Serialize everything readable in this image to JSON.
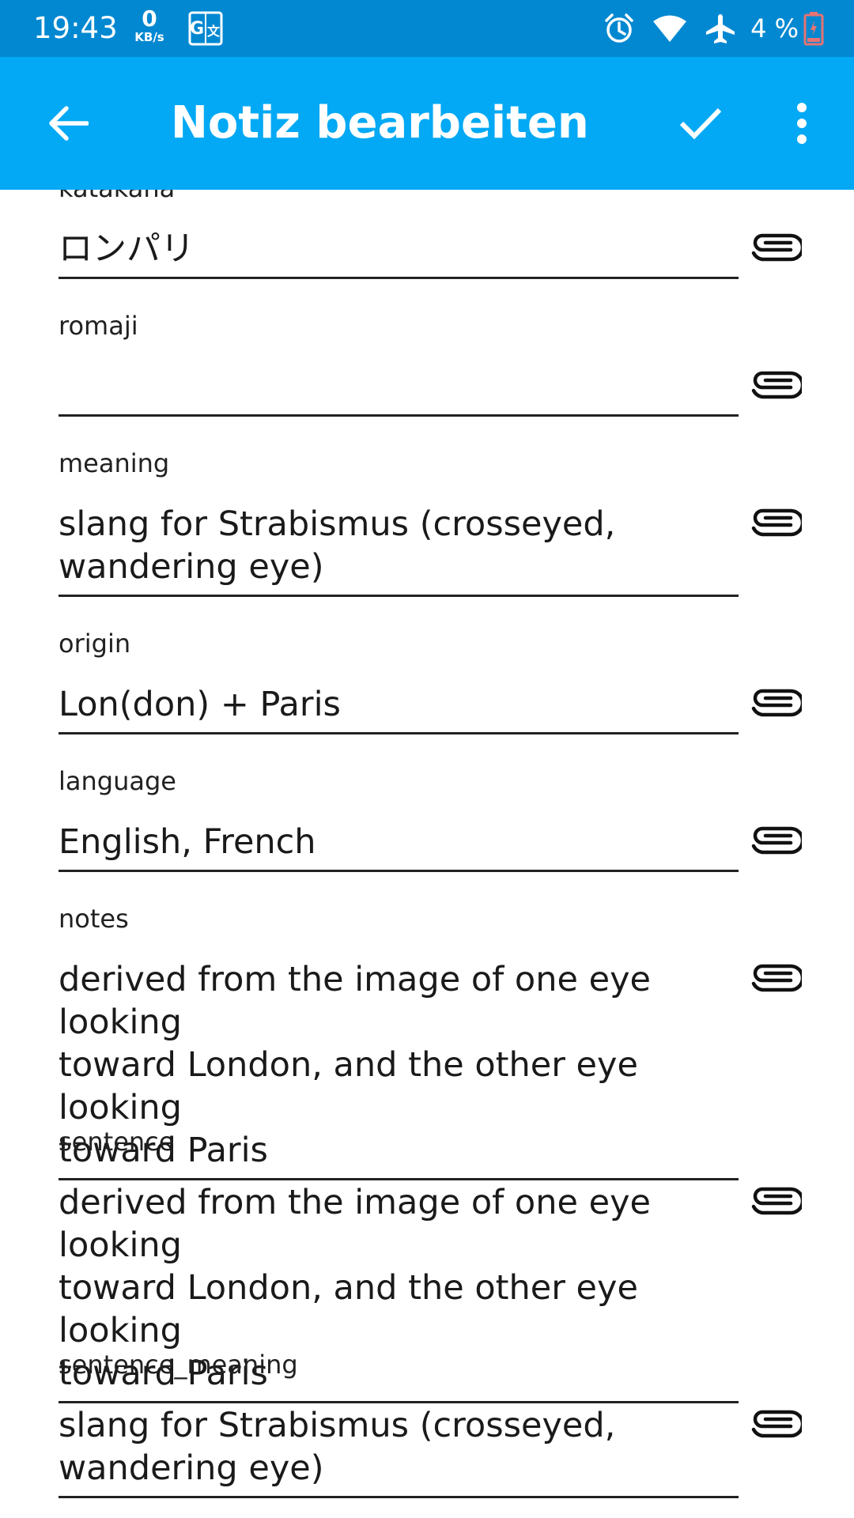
{
  "status_bar": {
    "time": "19:43",
    "speed_value": "0",
    "speed_unit": "KB/s",
    "translate_icon": "google-translate-icon",
    "alarm_icon": "alarm-icon",
    "wifi_icon": "wifi-icon",
    "airplane_icon": "airplane-icon",
    "battery_text": "4 %",
    "battery_icon": "battery-low-icon",
    "background": "#0288d1"
  },
  "app_bar": {
    "title": "Notiz bearbeiten",
    "back_icon": "arrow-back-icon",
    "save_icon": "checkmark-icon",
    "overflow_icon": "more-vert-icon",
    "background": "#03a9f4"
  },
  "fields": [
    {
      "label": "katakana",
      "value": "ロンパリ",
      "attach_icon": "paperclip-icon"
    },
    {
      "label": "romaji",
      "value": "",
      "attach_icon": "paperclip-icon"
    },
    {
      "label": "meaning",
      "value": "slang for Strabismus (crosseyed,\nwandering eye)",
      "attach_icon": "paperclip-icon"
    },
    {
      "label": "origin",
      "value": "Lon(don) + Paris",
      "attach_icon": "paperclip-icon"
    },
    {
      "label": "language",
      "value": "English, French",
      "attach_icon": "paperclip-icon"
    },
    {
      "label": "notes",
      "value": "derived from the image of one eye looking\ntoward London, and the other eye looking\ntoward Paris",
      "attach_icon": "paperclip-icon"
    },
    {
      "label": "sentence",
      "value": "derived from the image of one eye looking\ntoward London, and the other eye looking\ntoward Paris",
      "attach_icon": "paperclip-icon"
    },
    {
      "label": "sentence_meaning",
      "value": "slang for Strabismus (crosseyed,\nwandering eye)",
      "attach_icon": "paperclip-icon"
    }
  ]
}
